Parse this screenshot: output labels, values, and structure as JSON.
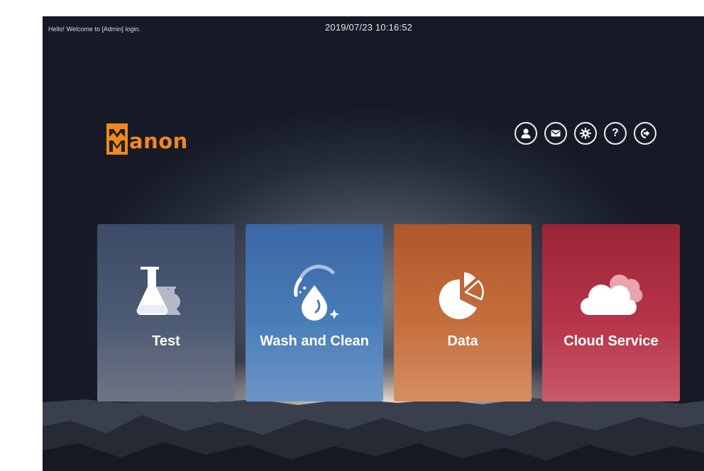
{
  "header": {
    "welcome": "Hello! Welcome to [Admin] login.",
    "datetime": "2019/07/23 10:16:52"
  },
  "brand": {
    "name": "anon",
    "color": "#f0891a"
  },
  "toolbar": {
    "buttons": [
      {
        "icon": "user-icon"
      },
      {
        "icon": "mail-icon"
      },
      {
        "icon": "settings-icon"
      },
      {
        "icon": "help-icon",
        "glyph": "?"
      },
      {
        "icon": "logout-icon"
      }
    ]
  },
  "tiles": [
    {
      "label": "Test",
      "icon": "flask-icon",
      "color": "#4b5872"
    },
    {
      "label": "Wash and Clean",
      "icon": "water-drop-icon",
      "color": "#4a7db8"
    },
    {
      "label": "Data",
      "icon": "pie-chart-icon",
      "color": "#c46e3d"
    },
    {
      "label": "Cloud Service",
      "icon": "cloud-icon",
      "color": "#b63448"
    }
  ]
}
